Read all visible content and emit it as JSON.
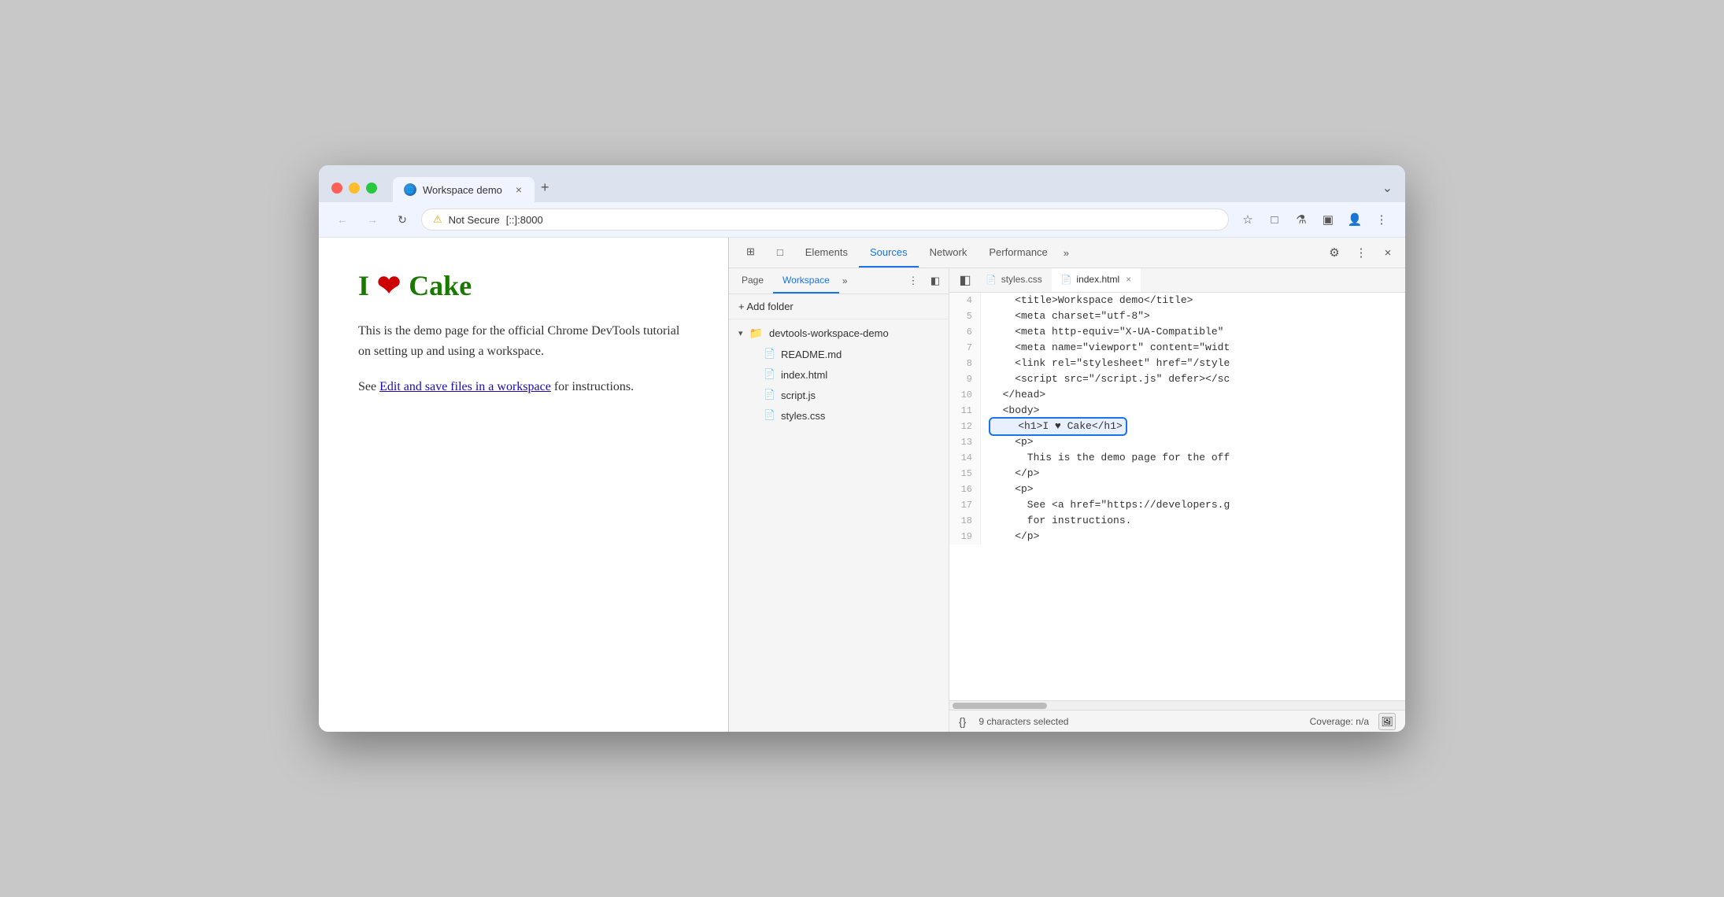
{
  "browser": {
    "tab": {
      "title": "Workspace demo",
      "close_label": "×"
    },
    "new_tab_label": "+",
    "chevron_label": "⌄",
    "nav": {
      "back_label": "←",
      "forward_label": "→",
      "reload_label": "↻",
      "security_warning": "⚠",
      "security_text": "Not Secure",
      "address": "[::]:8000",
      "bookmark_label": "☆",
      "extensions_label": "□",
      "experiments_label": "⚗",
      "sidebar_label": "▣",
      "profile_label": "👤",
      "menu_label": "⋮"
    }
  },
  "webpage": {
    "heading_green": "I",
    "heart": "❤",
    "heading_rest": "Cake",
    "para1": "This is the demo page for the official Chrome DevTools tutorial on setting up and using a workspace.",
    "para2_prefix": "See ",
    "link_text": "Edit and save files in a workspace",
    "para2_suffix": " for instructions."
  },
  "devtools": {
    "tabs": [
      {
        "label": "Elements",
        "active": false
      },
      {
        "label": "Sources",
        "active": true
      },
      {
        "label": "Network",
        "active": false
      },
      {
        "label": "Performance",
        "active": false
      }
    ],
    "more_tabs_label": "»",
    "settings_label": "⚙",
    "more_options_label": "⋮",
    "close_label": "×",
    "inspect_icon": "⊞",
    "device_icon": "□"
  },
  "sources": {
    "sidebar_tabs": [
      {
        "label": "Page",
        "active": false
      },
      {
        "label": "Workspace",
        "active": true
      }
    ],
    "more_label": "»",
    "menu_label": "⋮",
    "toggle_sidebar_label": "◧",
    "add_folder": "+ Add folder",
    "folder": {
      "name": "devtools-workspace-demo",
      "arrow": "▾",
      "icon": "📁"
    },
    "files": [
      {
        "name": "README.md",
        "type": "md"
      },
      {
        "name": "index.html",
        "type": "html"
      },
      {
        "name": "script.js",
        "type": "js"
      },
      {
        "name": "styles.css",
        "type": "css"
      }
    ],
    "file_tabs": [
      {
        "label": "styles.css",
        "type": "css",
        "active": false
      },
      {
        "label": "index.html",
        "type": "html",
        "active": true,
        "close": "×"
      }
    ],
    "code_lines": [
      {
        "num": "4",
        "content": "    <title>Workspace demo</title>",
        "highlighted": false
      },
      {
        "num": "5",
        "content": "    <meta charset=\"utf-8\">",
        "highlighted": false
      },
      {
        "num": "6",
        "content": "    <meta http-equiv=\"X-UA-Compatible\"",
        "highlighted": false
      },
      {
        "num": "7",
        "content": "    <meta name=\"viewport\" content=\"widt",
        "highlighted": false
      },
      {
        "num": "8",
        "content": "    <link rel=\"stylesheet\" href=\"/style",
        "highlighted": false
      },
      {
        "num": "9",
        "content": "    <script src=\"/script.js\" defer></sc",
        "highlighted": false
      },
      {
        "num": "10",
        "content": "  </head>",
        "highlighted": false
      },
      {
        "num": "11",
        "content": "  <body>",
        "highlighted": false
      },
      {
        "num": "12",
        "content": "    <h1>I ♥ Cake</h1>",
        "highlighted": true
      },
      {
        "num": "13",
        "content": "    <p>",
        "highlighted": false
      },
      {
        "num": "14",
        "content": "      This is the demo page for the off",
        "highlighted": false
      },
      {
        "num": "15",
        "content": "    </p>",
        "highlighted": false
      },
      {
        "num": "16",
        "content": "    <p>",
        "highlighted": false
      },
      {
        "num": "17",
        "content": "      See <a href=\"https://developers.g",
        "highlighted": false
      },
      {
        "num": "18",
        "content": "      for instructions.",
        "highlighted": false
      },
      {
        "num": "19",
        "content": "    </p>",
        "highlighted": false
      }
    ],
    "status": {
      "format_icon": "{}",
      "selected_text": "9 characters selected",
      "coverage": "Coverage: n/a"
    }
  }
}
